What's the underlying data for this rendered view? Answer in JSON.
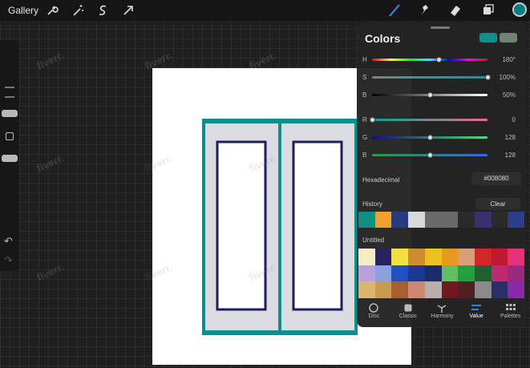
{
  "toolbar": {
    "gallery": "Gallery",
    "left_tools": [
      "wrench-icon",
      "magic-wand-icon",
      "selection-icon",
      "transform-arrow-icon"
    ],
    "right_tools": [
      "brush-icon",
      "smudge-icon",
      "eraser-icon",
      "layers-icon"
    ],
    "active_color": "#008080"
  },
  "colors_panel": {
    "title": "Colors",
    "primary_swatch": "#0f8f8a",
    "secondary_swatch": "#6d8571",
    "sliders": [
      {
        "label": "H",
        "value": "180°",
        "level": 0.58
      },
      {
        "label": "S",
        "value": "100%",
        "level": 1.0
      },
      {
        "label": "B",
        "value": "50%",
        "level": 0.5
      },
      {
        "label": "R",
        "value": "0",
        "level": 0.0
      },
      {
        "label": "G",
        "value": "128",
        "level": 0.5
      },
      {
        "label": "B",
        "value": "128",
        "level": 0.5
      }
    ],
    "hex_label": "Hexadecimal",
    "hex_value": "#008080",
    "history_label": "History",
    "clear_label": "Clear",
    "history": [
      "#0f8f86",
      "#f0a030",
      "#283a80",
      "#d8d8d8",
      "#6a6a6a",
      "#6a6a6a",
      "#2a2a2a",
      "#3a2f6e",
      "#2a2a2a",
      "#2c3e8a"
    ],
    "palette_label": "Untitled",
    "palette": [
      "#f4eec4",
      "#2a2260",
      "#f0e040",
      "#d08a30",
      "#f0c020",
      "#e89a20",
      "#d8a078",
      "#d02828",
      "#c01830",
      "#e8307a",
      "#b8a0e0",
      "#8aa0e0",
      "#2050c0",
      "#1a3a90",
      "#1a2a6a",
      "#60c060",
      "#20a040",
      "#206030",
      "#c02870",
      "#9a2a80",
      "#d8b870",
      "#c89a50",
      "#a86030",
      "#d08870",
      "#b8b0a8",
      "#701820",
      "#502020",
      "#8a8a8a",
      "#28306a",
      "#8a2aa8"
    ],
    "tabs": [
      {
        "label": "Disc",
        "icon": "disc-icon"
      },
      {
        "label": "Classic",
        "icon": "classic-square-icon"
      },
      {
        "label": "Harmony",
        "icon": "harmony-icon"
      },
      {
        "label": "Value",
        "icon": "value-sliders-icon"
      },
      {
        "label": "Palettes",
        "icon": "palettes-grid-icon"
      }
    ],
    "active_tab": "Value"
  },
  "watermark": "fiverr."
}
